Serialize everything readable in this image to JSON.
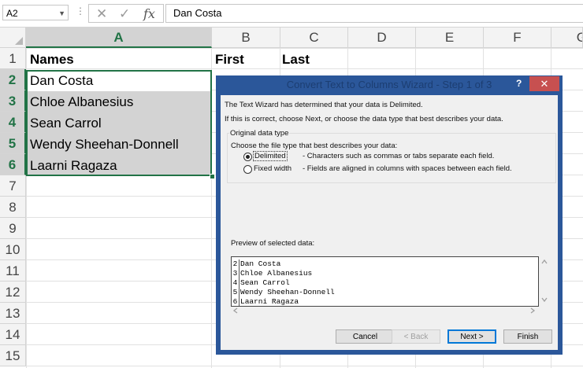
{
  "formula_bar": {
    "name_box": "A2",
    "fx_label": "fx",
    "content": "Dan Costa"
  },
  "columns": [
    "A",
    "B",
    "C",
    "D",
    "E",
    "F",
    "G"
  ],
  "rows": [
    "1",
    "2",
    "3",
    "4",
    "5",
    "6",
    "7",
    "8",
    "9",
    "10",
    "11",
    "12",
    "13",
    "14",
    "15"
  ],
  "cells": {
    "a1": "Names",
    "b1": "First",
    "c1": "Last",
    "names": [
      "Dan Costa",
      "Chloe Albanesius",
      "Sean Carrol",
      "Wendy Sheehan-Donnell",
      "Laarni Ragaza"
    ]
  },
  "dialog": {
    "title": "Convert Text to Columns Wizard - Step 1 of 3",
    "help": "?",
    "close": "✕",
    "intro1": "The Text Wizard has determined that your data is Delimited.",
    "intro2": "If this is correct, choose Next, or choose the data type that best describes your data.",
    "group_title": "Original data type",
    "choose_label": "Choose the file type that best describes your data:",
    "delimited_label": "Delimited",
    "delimited_desc": "- Characters such as commas or tabs separate each field.",
    "fixed_label": "Fixed width",
    "fixed_desc": "- Fields are aligned in columns with spaces between each field.",
    "selected_type": "Delimited",
    "preview_label": "Preview of selected data:",
    "preview_rows": [
      {
        "n": "2",
        "text": "Dan Costa"
      },
      {
        "n": "3",
        "text": "Chloe Albanesius"
      },
      {
        "n": "4",
        "text": "Sean Carrol"
      },
      {
        "n": "5",
        "text": "Wendy Sheehan-Donnell"
      },
      {
        "n": "6",
        "text": "Laarni Ragaza"
      }
    ],
    "buttons": {
      "cancel": "Cancel",
      "back": "< Back",
      "next": "Next >",
      "finish": "Finish"
    }
  },
  "colors": {
    "excel_green": "#217346",
    "dialog_frame": "#2b579a",
    "close_red": "#c75050"
  }
}
